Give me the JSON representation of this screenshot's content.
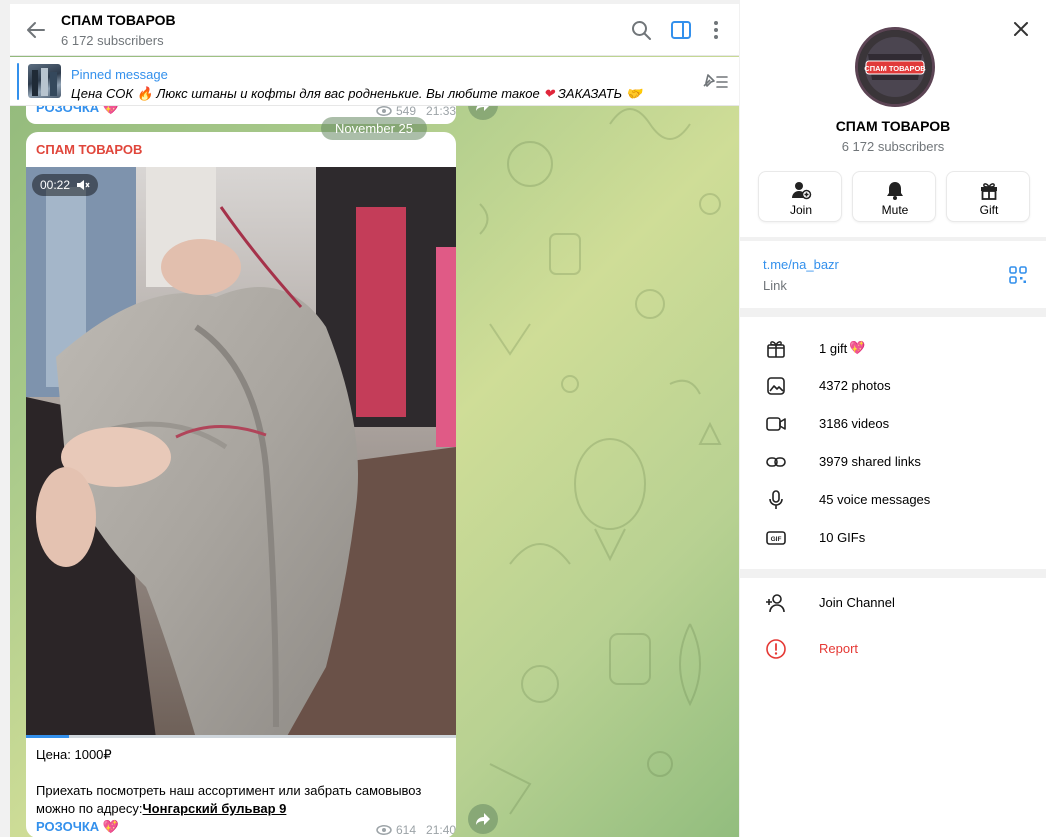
{
  "chat": {
    "title": "СПАМ ТОВАРОВ",
    "subscribers": "6 172 subscribers",
    "pinned": {
      "title": "Pinned message",
      "text_before": "Цена СОК",
      "text_middle": "Люкс штаны и кофты для вас родненькие.  Вы любите такое",
      "text_after": "ЗАКАЗАТЬ"
    },
    "prev_message": {
      "author_link": "РОЗОЧКА",
      "views": "549",
      "time": "21:33"
    },
    "date_separator": "November 25",
    "message": {
      "author": "СПАМ ТОВАРОВ",
      "video_duration": "00:22",
      "video_progress": 0.1,
      "caption_price": "Цена: 1000₽",
      "caption_line2": "Приехать посмотреть наш ассортимент или забрать самовывоз",
      "caption_line3_prefix": "можно по адресу:",
      "caption_address": "Чонгарский бульвар 9",
      "author_link": "РОЗОЧКА",
      "views": "614",
      "time": "21:40"
    }
  },
  "side": {
    "title": "СПАМ ТОВАРОВ",
    "subscribers": "6 172 subscribers",
    "avatar_text": "СПАМ ТОВАРОВ",
    "actions": [
      {
        "label": "Join",
        "icon": "add-user-icon"
      },
      {
        "label": "Mute",
        "icon": "bell-icon"
      },
      {
        "label": "Gift",
        "icon": "gift-icon"
      }
    ],
    "link": {
      "url": "t.me/na_bazr",
      "label": "Link"
    },
    "media": [
      {
        "label": "1 gift",
        "icon": "gift-box-icon"
      },
      {
        "label": "4372 photos",
        "icon": "photo-icon"
      },
      {
        "label": "3186 videos",
        "icon": "video-icon"
      },
      {
        "label": "3979 shared links",
        "icon": "link-icon"
      },
      {
        "label": "45 voice messages",
        "icon": "microphone-icon"
      },
      {
        "label": "10 GIFs",
        "icon": "gif-icon"
      }
    ],
    "join_channel": "Join Channel",
    "report": "Report"
  },
  "colors": {
    "accent": "#3390ec",
    "author_red": "#e0463b",
    "report_red": "#e53935",
    "muted": "#707579"
  }
}
